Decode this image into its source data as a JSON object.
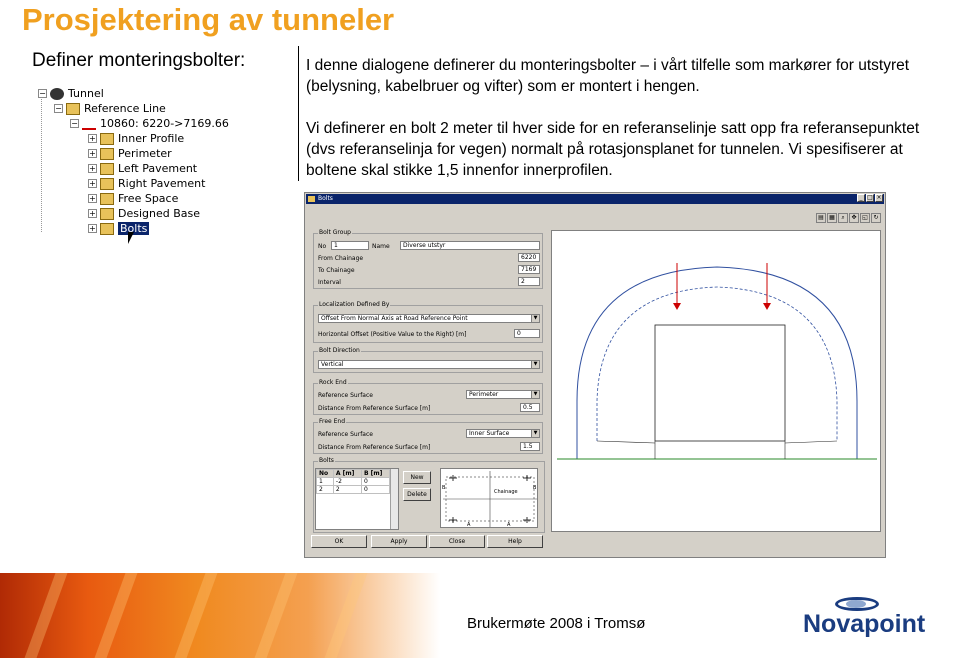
{
  "slide": {
    "title": "Prosjektering av tunneler",
    "subtitle": "Definer monteringsbolter:",
    "paragraph1": "I denne dialogene definerer du monteringsbolter – i vårt tilfelle som markører for utstyret (belysning, kabelbruer og vifter) som er montert i hengen.",
    "paragraph2": "Vi definerer en bolt 2 meter til hver side for en referanselinje satt opp fra referansepunktet (dvs referanselinja for vegen) normalt på rotasjonsplanet for tunnelen. Vi spesifiserer at boltene skal stikke 1,5 innenfor innerprofilen."
  },
  "tree": {
    "items": [
      {
        "label": "Tunnel",
        "toggle": "−"
      },
      {
        "label": "Reference Line",
        "toggle": "−"
      },
      {
        "label": "10860: 6220->7169.66",
        "toggle": "−"
      },
      {
        "label": "Inner Profile",
        "toggle": "+"
      },
      {
        "label": "Perimeter",
        "toggle": "+"
      },
      {
        "label": "Left Pavement",
        "toggle": "+"
      },
      {
        "label": "Right Pavement",
        "toggle": "+"
      },
      {
        "label": "Free Space",
        "toggle": "+"
      },
      {
        "label": "Designed Base",
        "toggle": "+"
      },
      {
        "label": "Bolts",
        "toggle": "+"
      }
    ]
  },
  "dialog": {
    "title": "Bolts",
    "bolt_group": {
      "title": "Bolt Group",
      "no_label": "No",
      "no_value": "1",
      "name_label": "Name",
      "name_value": "Diverse utstyr",
      "from_chainage_label": "From Chainage",
      "from_chainage_value": "6220",
      "to_chainage_label": "To Chainage",
      "to_chainage_value": "7169",
      "interval_label": "Interval",
      "interval_value": "2"
    },
    "localization": {
      "title": "Localization Defined By",
      "option": "Offset From Normal Axis at Road Reference Point",
      "offset_label": "Horizontal Offset (Positive Value to the Right) [m]",
      "offset_value": "0"
    },
    "bolt_direction": {
      "title": "Bolt Direction",
      "option": "Vertical"
    },
    "rock_end": {
      "title": "Rock End",
      "surface_label": "Reference Surface",
      "surface_value": "Perimeter",
      "distance_label": "Distance From Reference Surface [m]",
      "distance_value": "0.5"
    },
    "free_end": {
      "title": "Free End",
      "surface_label": "Reference Surface",
      "surface_value": "Inner Surface",
      "distance_label": "Distance From Reference Surface [m]",
      "distance_value": "1.5"
    },
    "bolts": {
      "title": "Bolts",
      "columns": [
        "No",
        "A [m]",
        "B [m]"
      ],
      "rows": [
        [
          "1",
          "-2",
          "0"
        ],
        [
          "2",
          "2",
          "0"
        ]
      ],
      "new_label": "New",
      "delete_label": "Delete",
      "chainage_label": "Chainage",
      "a_label": "A",
      "b_label": "B"
    },
    "buttons": {
      "ok": "OK",
      "apply": "Apply",
      "close": "Close",
      "help": "Help"
    }
  },
  "footer": {
    "text": "Brukermøte 2008 i Tromsø",
    "logo": "Novapoint"
  },
  "colors": {
    "title": "#f0a020",
    "selection": "#0a246a",
    "logo": "#1a3c80",
    "bolt_marker": "#cc0000",
    "pavement_line": "#2a8a2a",
    "profile_line": "#3050a0"
  }
}
